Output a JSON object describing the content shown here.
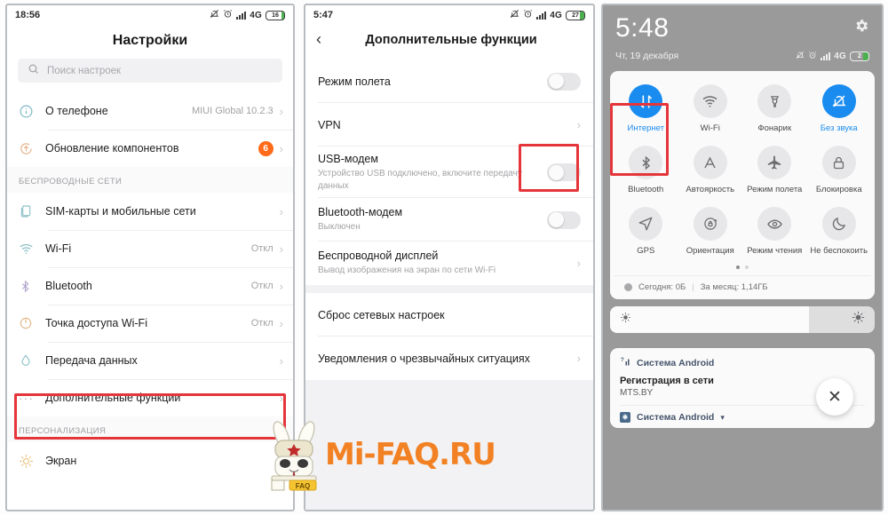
{
  "panel_settings": {
    "statusbar": {
      "time": "18:56",
      "network": "4G",
      "battery": "16"
    },
    "title": "Настройки",
    "search_placeholder": "Поиск настроек",
    "items": [
      {
        "label": "О телефоне",
        "value": "MIUI Global 10.2.3",
        "icon": "info-icon"
      },
      {
        "label": "Обновление компонентов",
        "badge": "6",
        "icon": "update-icon"
      }
    ],
    "section_wireless": "БЕСПРОВОДНЫЕ СЕТИ",
    "wireless_items": [
      {
        "label": "SIM-карты и мобильные сети",
        "value": "",
        "icon": "sim-icon"
      },
      {
        "label": "Wi-Fi",
        "value": "Откл",
        "icon": "wifi-icon"
      },
      {
        "label": "Bluetooth",
        "value": "Откл",
        "icon": "bluetooth-icon"
      },
      {
        "label": "Точка доступа Wi-Fi",
        "value": "Откл",
        "icon": "hotspot-icon"
      },
      {
        "label": "Передача данных",
        "value": "",
        "icon": "data-icon"
      },
      {
        "label": "Дополнительные функции",
        "value": "",
        "icon": "dots-icon"
      }
    ],
    "section_personal": "ПЕРСОНАЛИЗАЦИЯ",
    "personal_items": [
      {
        "label": "Экран",
        "value": "",
        "icon": "brightness-icon"
      }
    ]
  },
  "panel_extra": {
    "statusbar": {
      "time": "5:47",
      "network": "4G",
      "battery": "27"
    },
    "title": "Дополнительные функции",
    "rows": [
      {
        "title": "Режим полета",
        "sub": "",
        "control": "toggle-off"
      },
      {
        "title": "VPN",
        "sub": "",
        "control": "chevron"
      },
      {
        "title": "USB-модем",
        "sub": "Устройство USB подключено, включите передачу данных",
        "control": "toggle-off"
      },
      {
        "title": "Bluetooth-модем",
        "sub": "Выключен",
        "control": "toggle-off"
      },
      {
        "title": "Беспроводной дисплей",
        "sub": "Вывод изображения на экран по сети Wi-Fi",
        "control": "chevron"
      },
      {
        "title": "Сброс сетевых настроек",
        "sub": "",
        "control": "none"
      },
      {
        "title": "Уведомления о чрезвычайных ситуациях",
        "sub": "",
        "control": "chevron"
      }
    ]
  },
  "panel_control": {
    "clock": "5:48",
    "date": "Чт, 19 декабря",
    "statusbar": {
      "network": "4G",
      "battery": "2"
    },
    "tiles": [
      {
        "label": "Интернет",
        "icon": "data-transfer-icon",
        "active": true
      },
      {
        "label": "Wi-Fi",
        "icon": "wifi-icon",
        "active": false
      },
      {
        "label": "Фонарик",
        "icon": "flashlight-icon",
        "active": false
      },
      {
        "label": "Без звука",
        "icon": "mute-bell-icon",
        "active": true
      },
      {
        "label": "Bluetooth",
        "icon": "bluetooth-icon",
        "active": false
      },
      {
        "label": "Автояркость",
        "icon": "auto-brightness-icon",
        "active": false
      },
      {
        "label": "Режим полета",
        "icon": "airplane-icon",
        "active": false
      },
      {
        "label": "Блокировка",
        "icon": "lock-icon",
        "active": false
      },
      {
        "label": "GPS",
        "icon": "location-icon",
        "active": false
      },
      {
        "label": "Ориентация",
        "icon": "rotate-lock-icon",
        "active": false
      },
      {
        "label": "Режим чтения",
        "icon": "eye-icon",
        "active": false
      },
      {
        "label": "Не беспокоить",
        "icon": "moon-icon",
        "active": false
      }
    ],
    "data_today": "Сегодня: 0Б",
    "data_separator": "|",
    "data_month": "За месяц: 1,14ГБ",
    "brightness_percent": 75,
    "notifications": [
      {
        "app": "Система Android",
        "title": "Регистрация в сети",
        "sub": "MTS.BY",
        "icon": "signal-unknown-icon"
      },
      {
        "app": "Система Android",
        "title": "",
        "sub": "",
        "icon": "usb-icon"
      }
    ],
    "close_label": "✕"
  },
  "watermark": {
    "text": "Mi-FAQ.RU",
    "badge": "FAQ",
    "color": "#f28124"
  },
  "highlight_color": "#e5353a"
}
